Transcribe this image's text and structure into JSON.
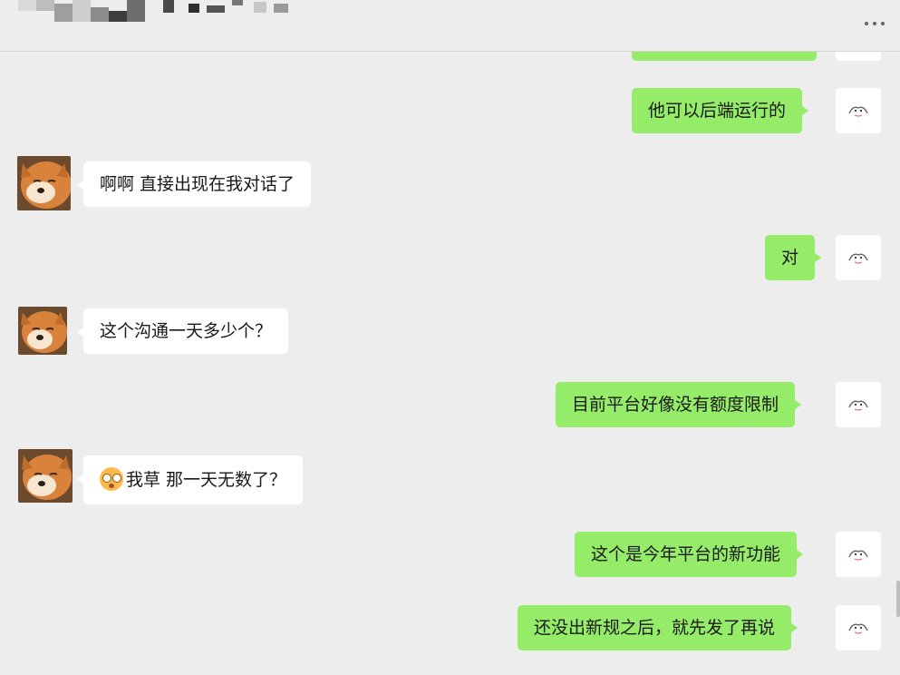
{
  "header": {
    "more_icon": "more-dots-icon"
  },
  "messages": [
    {
      "from": "me",
      "text": ""
    },
    {
      "from": "me",
      "text": "他可以后端运行的"
    },
    {
      "from": "them",
      "text": "啊啊 直接出现在我对话了"
    },
    {
      "from": "me",
      "text": "对"
    },
    {
      "from": "them",
      "text": "这个沟通一天多少个？"
    },
    {
      "from": "me",
      "text": "目前平台好像没有额度限制"
    },
    {
      "from": "them",
      "emoji": "flushed-face-emoji",
      "text": "我草 那一天无数了？"
    },
    {
      "from": "me",
      "text": "这个是今年平台的新功能"
    },
    {
      "from": "me",
      "text": "还没出新规之后，就先发了再说"
    }
  ],
  "colors": {
    "my_bubble": "#95ec69",
    "their_bubble": "#ffffff",
    "background": "#ededed"
  }
}
